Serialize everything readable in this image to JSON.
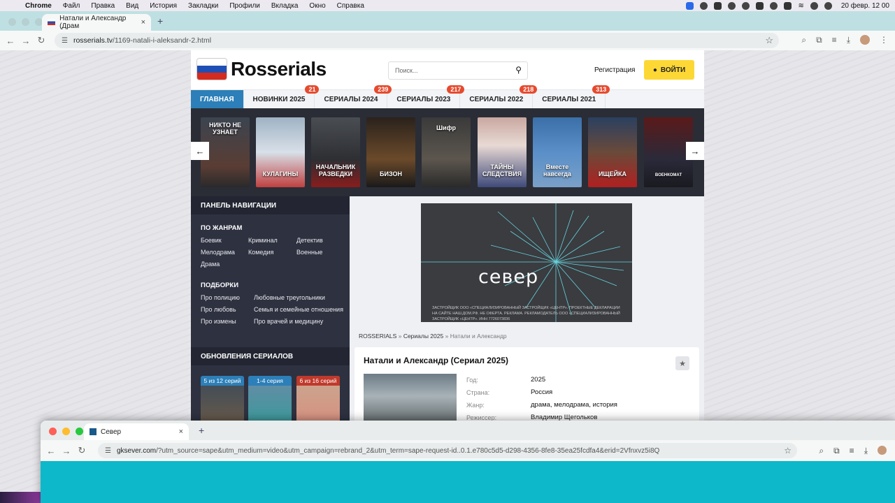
{
  "menubar": {
    "app": "Chrome",
    "items": [
      "Файл",
      "Правка",
      "Вид",
      "История",
      "Закладки",
      "Профили",
      "Вкладка",
      "Окно",
      "Справка"
    ],
    "clock": "20 февр.  12 00"
  },
  "browser": {
    "tab_title": "Натали и Александр (Драм",
    "url_host": "rosserials.tv",
    "url_path": "/1169-natali-i-aleksandr-2.html"
  },
  "site": {
    "logo": "Rosserials",
    "search_placeholder": "Поиск...",
    "register": "Регистрация",
    "login": "ВОЙТИ",
    "nav": [
      {
        "label": "ГЛАВНАЯ",
        "badge": ""
      },
      {
        "label": "НОВИНКИ 2025",
        "badge": "21"
      },
      {
        "label": "СЕРИАЛЫ 2024",
        "badge": "239"
      },
      {
        "label": "СЕРИАЛЫ 2023",
        "badge": "217"
      },
      {
        "label": "СЕРИАЛЫ 2022",
        "badge": "218"
      },
      {
        "label": "СЕРИАЛЫ 2021",
        "badge": "313"
      }
    ],
    "posters": [
      {
        "title": "НИКТО НЕ УЗНАЕТ"
      },
      {
        "title": "КУЛАГИНЫ"
      },
      {
        "title": "НАЧАЛЬНИК РАЗВЕДКИ"
      },
      {
        "title": "БИЗОН"
      },
      {
        "title": "Шифр"
      },
      {
        "title": "ТАЙНЫ СЛЕДСТВИЯ"
      },
      {
        "title": "Вместе навсегда"
      },
      {
        "title": "ИЩЕЙКА"
      },
      {
        "title": "ВОЕНКОМАТ"
      }
    ],
    "sidebar": {
      "header": "ПАНЕЛЬ НАВИГАЦИИ",
      "genres_title": "ПО ЖАНРАМ",
      "genres": [
        "Боевик",
        "Криминал",
        "Детектив",
        "Мелодрама",
        "Комедия",
        "Военные",
        "Драма"
      ],
      "collections_title": "ПОДБОРКИ",
      "collections": [
        "Про полицию",
        "Любовные треугольники",
        "Про любовь",
        "Семья и семейные отношения",
        "Про измены",
        "Про врачей и медицину"
      ],
      "updates_title": "ОБНОВЛЕНИЯ СЕРИАЛОВ",
      "updates": [
        "5 из 12 серий",
        "1-4 серия",
        "6 из 16 серий"
      ]
    },
    "ad": {
      "brand": "север",
      "fine": "ЗАСТРОЙЩИК ООО «СПЕЦИАЛИЗИРОВАННЫЙ ЗАСТРОЙЩИК «ЦЕНТР». ПРОЕКТНЫЕ ДЕКЛАРАЦИИ НА САЙТЕ НАШ.ДОМ.РФ. НЕ ОФЕРТА. РЕКЛАМА. РЕКЛАМОДАТЕЛЬ ООО «СПЕЦИАЛИЗИРОВАННЫЙ ЗАСТРОЙЩИК «ЦЕНТР». ИНН 7726073836"
    },
    "breadcrumb": {
      "home": "ROSSERIALS",
      "sep": "»",
      "section": "Сериалы 2025",
      "current": "Натали и Александр"
    },
    "card": {
      "title": "Натали и Александр (Сериал 2025)",
      "fields": [
        {
          "label": "Год:",
          "value": "2025"
        },
        {
          "label": "Страна:",
          "value": "Россия"
        },
        {
          "label": "Жанр:",
          "value": "драма, мелодрама, история"
        },
        {
          "label": "Режиссер:",
          "value": "Владимир Щегольков"
        }
      ]
    }
  },
  "popup": {
    "tab_title": "Север",
    "url_host": "gksever.com",
    "url_path": "/?utm_source=sape&utm_medium=video&utm_campaign=rebrand_2&utm_term=sape-request-id..0.1.e780c5d5-d298-4356-8fe8-35ea25fcdfa4&erid=2Vfnxvz5i8Q",
    "page_color": "#0cb8c9"
  },
  "colors": {
    "accent_blue": "#2c7fb8",
    "badge_red": "#e64a2e",
    "login_yellow": "#fdd835",
    "sidebar_dark": "#2e3140"
  }
}
